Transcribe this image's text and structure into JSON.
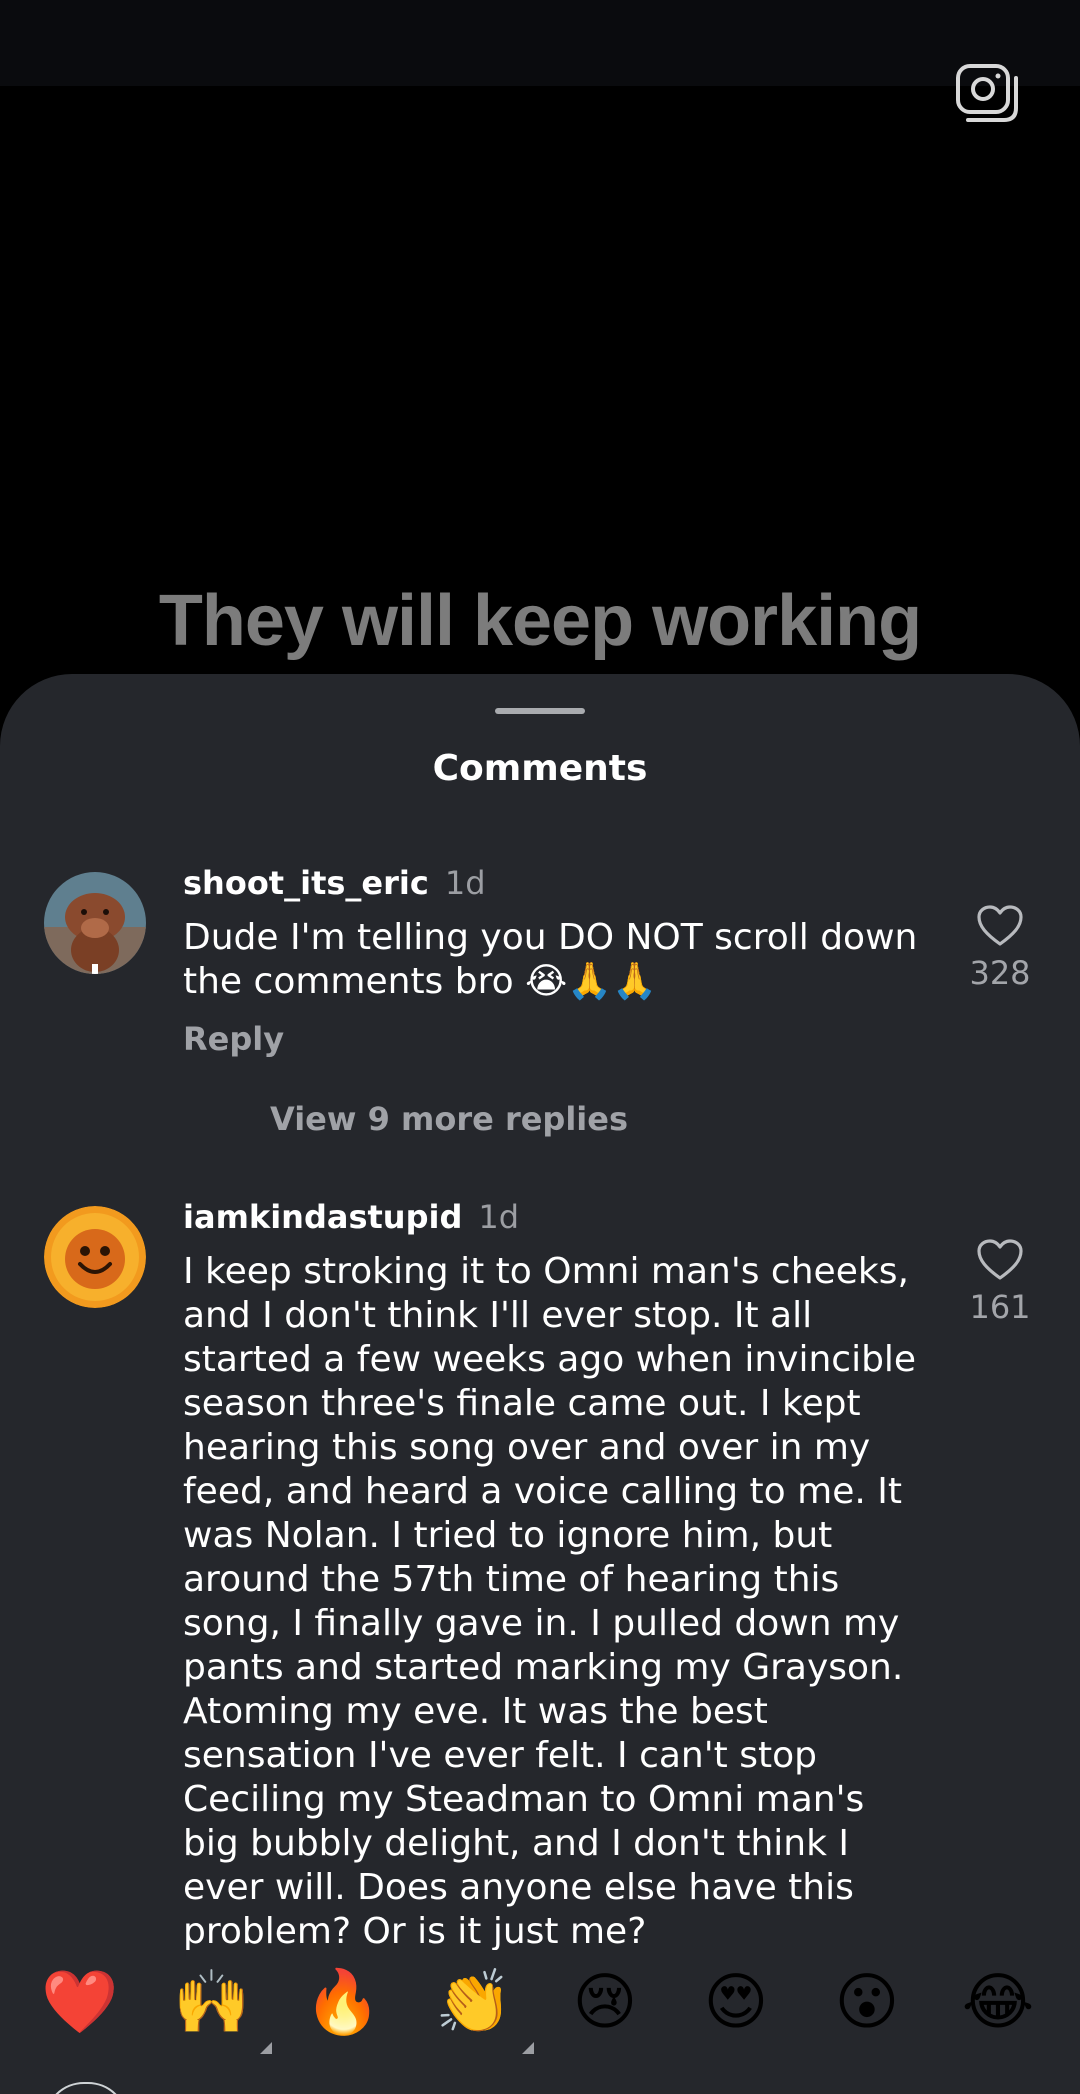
{
  "reel": {
    "caption": "They will keep working"
  },
  "sheet": {
    "title": "Comments"
  },
  "comments": [
    {
      "username": "shoot_its_eric",
      "time": "1d",
      "text": "Dude I'm telling you DO NOT scroll down the comments bro 😭🙏🙏",
      "reply_label": "Reply",
      "likes": "328",
      "view_replies": "View 9 more replies"
    },
    {
      "username": "iamkindastupid",
      "time": "1d",
      "text": "I keep stroking it to Omni man's cheeks, and I don't think I'll ever stop. It all started a few weeks ago when invincible season three's finale came out. I kept hearing this song over and over in my feed, and heard a voice calling to me. It was Nolan. I tried to ignore him, but around the 57th time of hearing this song, I finally gave in. I pulled down my pants and started marking my Grayson. Atoming my eve. It was the best sensation I've ever felt. I can't stop Ceciling my Steadman to Omni man's big bubbly delight, and I don't think I ever will. Does anyone else have this problem? Or is it just me?",
      "likes": "161"
    }
  ],
  "reactions": [
    "❤️",
    "🙌",
    "🔥",
    "👏",
    "😢",
    "😍",
    "😮",
    "😂"
  ],
  "colors": {
    "sheet_bg": "#25272c",
    "caption": "#7c7c7c",
    "muted_text": "#a0a2a7"
  }
}
